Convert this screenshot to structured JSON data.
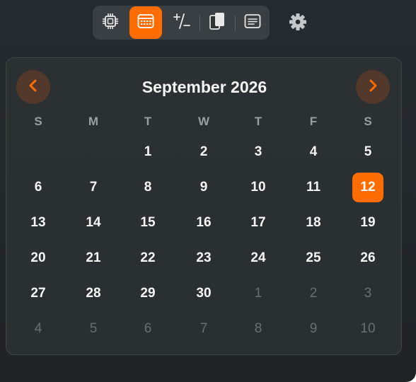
{
  "toolbar": {
    "items": [
      {
        "name": "cpu-icon",
        "active": false
      },
      {
        "name": "calendar-icon",
        "active": true
      },
      {
        "name": "plus-minus-icon",
        "active": false
      },
      {
        "name": "clipboard-icon",
        "active": false
      },
      {
        "name": "notes-icon",
        "active": false
      }
    ],
    "accent": "#ff6d00",
    "settings_icon": "gear-icon"
  },
  "calendar": {
    "title": "September 2026",
    "prev_icon": "chevron-left-icon",
    "next_icon": "chevron-right-icon",
    "weekdays": [
      "S",
      "M",
      "T",
      "W",
      "T",
      "F",
      "S"
    ],
    "weeks": [
      [
        {
          "label": ""
        },
        {
          "label": ""
        },
        {
          "label": "1"
        },
        {
          "label": "2"
        },
        {
          "label": "3"
        },
        {
          "label": "4"
        },
        {
          "label": "5"
        }
      ],
      [
        {
          "label": "6"
        },
        {
          "label": "7"
        },
        {
          "label": "8"
        },
        {
          "label": "9"
        },
        {
          "label": "10"
        },
        {
          "label": "11"
        },
        {
          "label": "12",
          "today": true
        }
      ],
      [
        {
          "label": "13"
        },
        {
          "label": "14"
        },
        {
          "label": "15"
        },
        {
          "label": "16"
        },
        {
          "label": "17"
        },
        {
          "label": "18"
        },
        {
          "label": "19"
        }
      ],
      [
        {
          "label": "20"
        },
        {
          "label": "21"
        },
        {
          "label": "22"
        },
        {
          "label": "23"
        },
        {
          "label": "24"
        },
        {
          "label": "25"
        },
        {
          "label": "26"
        }
      ],
      [
        {
          "label": "27"
        },
        {
          "label": "28"
        },
        {
          "label": "29"
        },
        {
          "label": "30"
        },
        {
          "label": "1",
          "other": true
        },
        {
          "label": "2",
          "other": true
        },
        {
          "label": "3",
          "other": true
        }
      ],
      [
        {
          "label": "4",
          "other": true
        },
        {
          "label": "5",
          "other": true
        },
        {
          "label": "6",
          "other": true
        },
        {
          "label": "7",
          "other": true
        },
        {
          "label": "8",
          "other": true
        },
        {
          "label": "9",
          "other": true
        },
        {
          "label": "10",
          "other": true
        }
      ]
    ]
  }
}
